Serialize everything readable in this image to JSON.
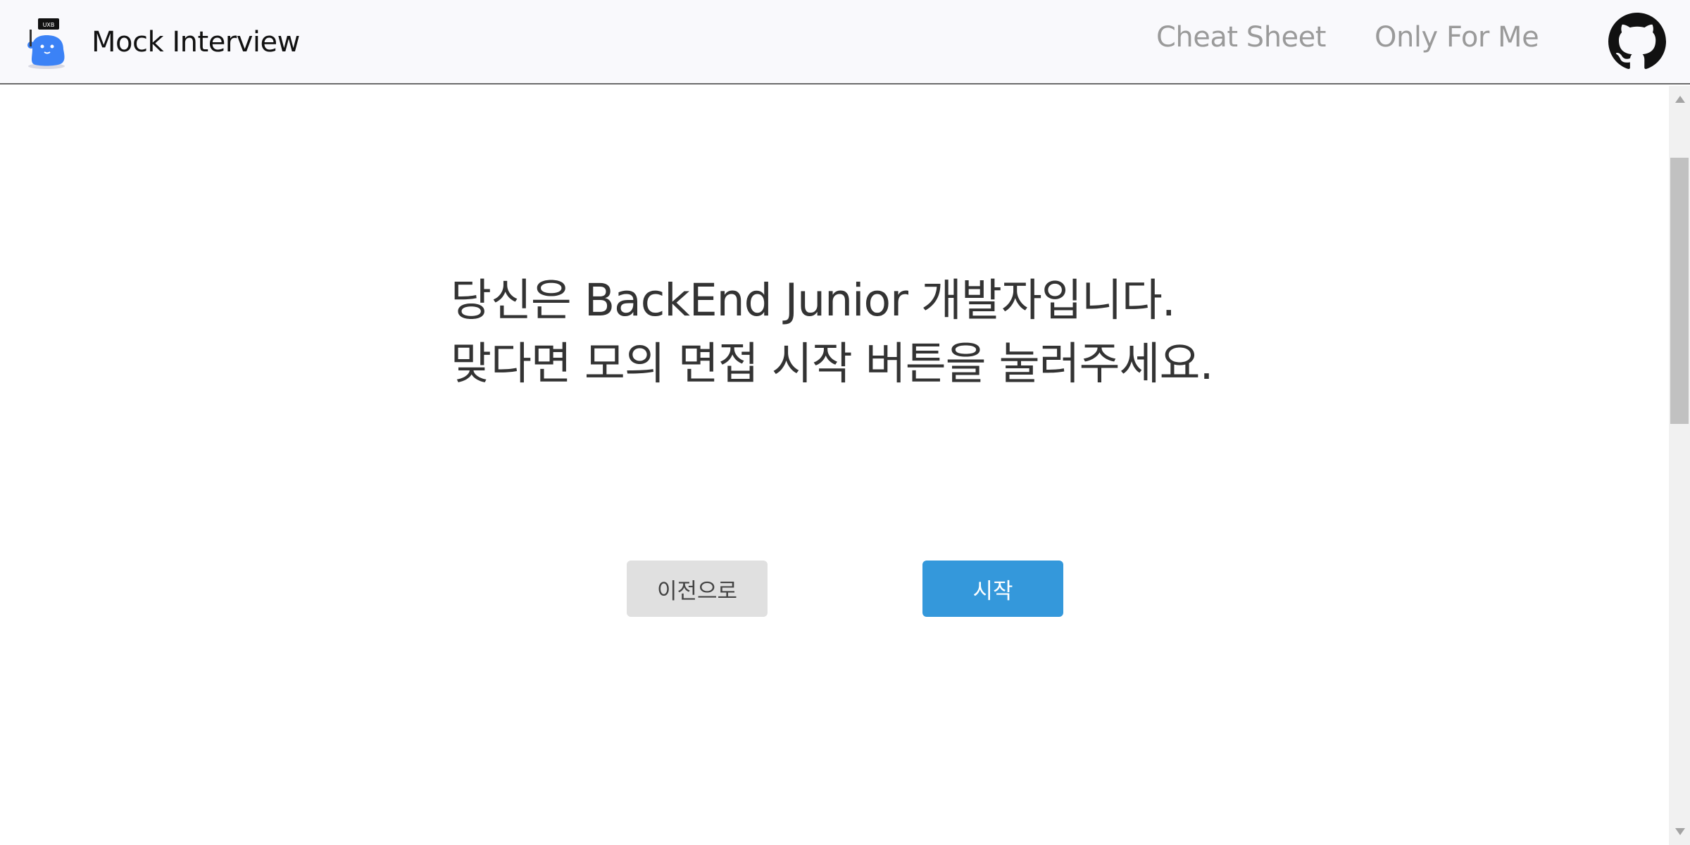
{
  "navbar": {
    "brand": {
      "title": "Mock Interview",
      "logo_icon": "blue-mascot-logo-icon",
      "logo_text": "UXB"
    },
    "links": [
      {
        "label": "Cheat Sheet"
      },
      {
        "label": "Only For Me"
      }
    ],
    "github_icon": "github-icon"
  },
  "main": {
    "headline_line1": "당신은 BackEnd Junior 개발자입니다.",
    "headline_line2": "맞다면 모의 면접 시작 버튼을 눌러주세요.",
    "buttons": {
      "prev_label": "이전으로",
      "start_label": "시작"
    }
  },
  "colors": {
    "navbar_bg": "#f9f9fc",
    "start_button": "#3498db",
    "prev_button": "#e0e0e0",
    "headline_text": "#333333",
    "nav_link_text": "#9a9a9a"
  }
}
